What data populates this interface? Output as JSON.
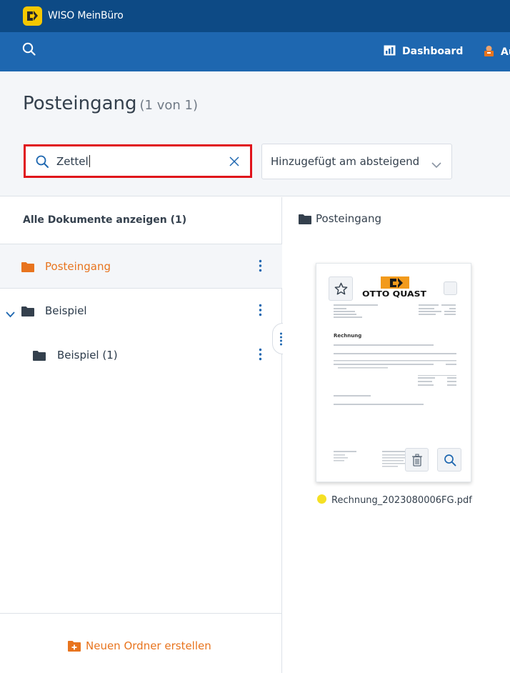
{
  "app": {
    "title": "WISO MeinBüro"
  },
  "nav": {
    "items": [
      {
        "label": "Dashboard",
        "icon": "dashboard-chart-icon"
      },
      {
        "label": "Au",
        "icon": "orders-icon"
      }
    ]
  },
  "page": {
    "title": "Posteingang",
    "count": "(1 von 1)"
  },
  "search": {
    "value": "Zettel"
  },
  "sort": {
    "selected": "Hinzugefügt am absteigend"
  },
  "sidebar": {
    "all_docs_label": "Alle Dokumente anzeigen (1)",
    "folders": [
      {
        "label": "Posteingang",
        "active": true
      },
      {
        "label": "Beispiel",
        "expanded": true
      },
      {
        "label": "Beispiel (1)"
      }
    ],
    "new_folder_label": "Neuen Ordner erstellen"
  },
  "content": {
    "folder_title": "Posteingang",
    "documents": [
      {
        "filename": "Rechnung_2023080006FG.pdf",
        "status_color": "#f5e024",
        "preview_logo": "OTTO QUAST",
        "preview_heading": "Rechnung"
      }
    ]
  },
  "colors": {
    "topbar": "#0d4a85",
    "navbar": "#1e67b0",
    "accent_orange": "#e8741e",
    "search_highlight": "#e0131b",
    "logo_yellow": "#f6c800"
  }
}
